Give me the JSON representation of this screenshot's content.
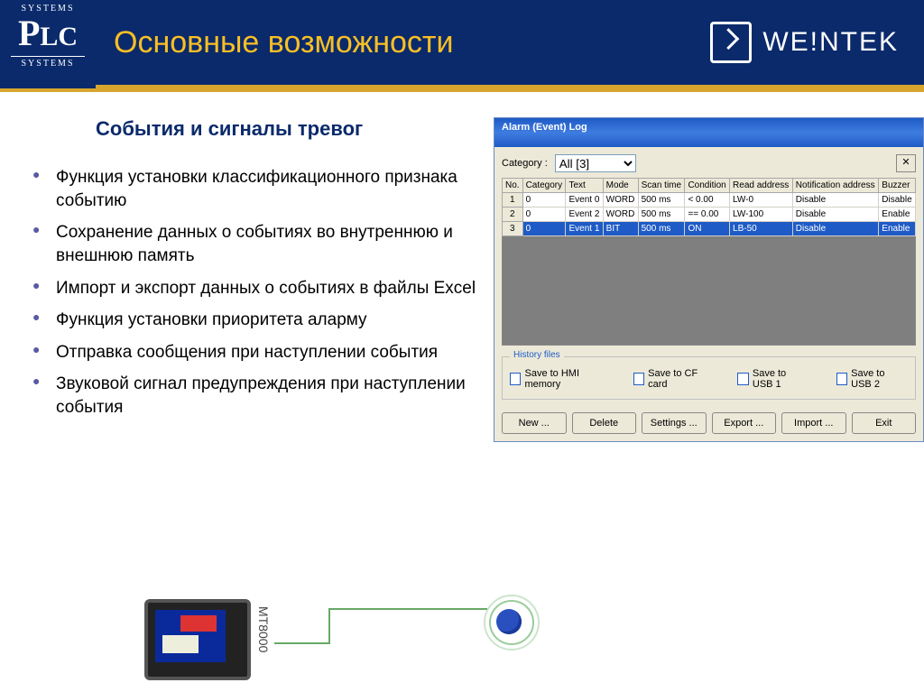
{
  "header": {
    "title": "Основные возможности",
    "brand": "WE!NTEK",
    "logo_top": "SYSTEMS",
    "logo_bot": "SYSTEMS"
  },
  "subtitle": "События и сигналы тревог",
  "bullets": [
    "Функция установки классификационного признака событию",
    "Сохранение данных о событиях во внутреннюю и внешнюю память",
    "Импорт и экспорт данных о событиях в файлы Excel",
    "Функция установки приоритета аларму",
    "Отправка сообщения при наступлении события",
    "Звуковой сигнал предупреждения при наступлении события"
  ],
  "dialog": {
    "title": "Alarm (Event) Log",
    "category_label": "Category :",
    "category_value": "All [3]",
    "columns": [
      "No.",
      "Category",
      "Text",
      "Mode",
      "Scan time",
      "Condition",
      "Read address",
      "Notification address",
      "Buzzer"
    ],
    "rows": [
      {
        "no": "1",
        "cat": "0",
        "text": "Event 0",
        "mode": "WORD",
        "scan": "500 ms",
        "cond": "<  0.00",
        "read": "LW-0",
        "notif": "Disable",
        "buz": "Disable"
      },
      {
        "no": "2",
        "cat": "0",
        "text": "Event 2",
        "mode": "WORD",
        "scan": "500 ms",
        "cond": "==  0.00",
        "read": "LW-100",
        "notif": "Disable",
        "buz": "Enable"
      },
      {
        "no": "3",
        "cat": "0",
        "text": "Event 1",
        "mode": "BIT",
        "scan": "500 ms",
        "cond": "ON",
        "read": "LB-50",
        "notif": "Disable",
        "buz": "Enable"
      }
    ],
    "history_legend": "History files",
    "checks": [
      "Save to HMI memory",
      "Save to CF card",
      "Save to USB 1",
      "Save to USB 2"
    ],
    "buttons": [
      "New ...",
      "Delete",
      "Settings ...",
      "Export ...",
      "Import ...",
      "Exit"
    ]
  },
  "device_label": "MT8000"
}
